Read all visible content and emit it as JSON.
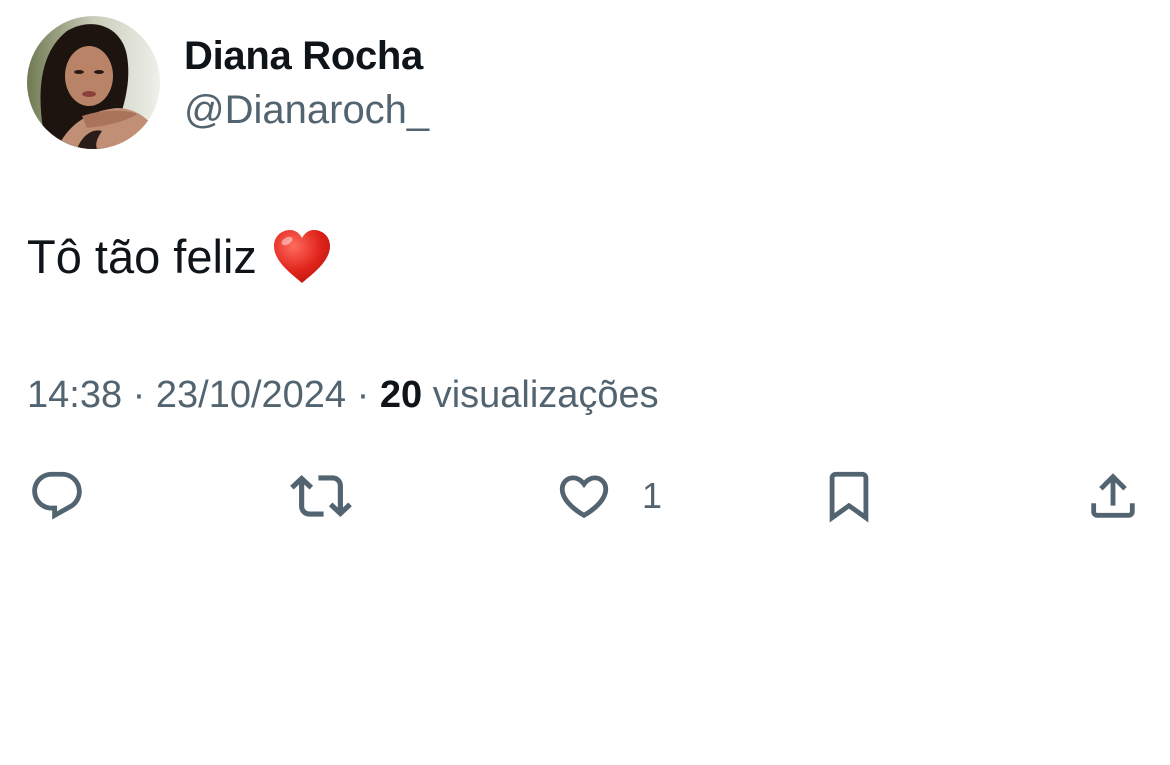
{
  "author": {
    "display_name": "Diana Rocha",
    "handle": "@Dianaroch_",
    "avatar_icon": "profile-photo"
  },
  "tweet": {
    "text": "Tô tão feliz",
    "emoji": "red-heart-emoji",
    "time": "14:38",
    "separator": "·",
    "date": "23/10/2024",
    "views_count": "20",
    "views_label": "visualizações"
  },
  "actions": {
    "reply_icon": "reply-icon",
    "retweet_icon": "retweet-icon",
    "like_icon": "heart-icon",
    "like_count": "1",
    "bookmark_icon": "bookmark-icon",
    "share_icon": "share-icon"
  },
  "colors": {
    "primary_text": "#0f1419",
    "secondary_text": "#536471",
    "heart_emoji": "#e0241b",
    "background": "#ffffff"
  }
}
